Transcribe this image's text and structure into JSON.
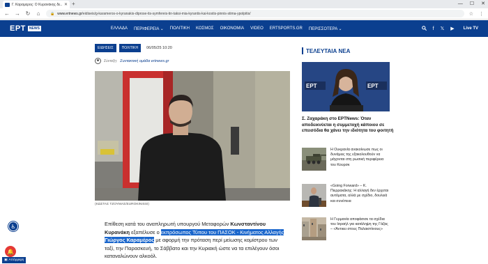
{
  "browser": {
    "tab_title": "Γ. Καραμέρος: Ο Κυρανάκης δε...",
    "new_tab": "+",
    "url_host": "www.ertnews.gr",
    "url_path": "/eidiseis/g-karameros-o-kyranakis-diprose-tis-symfereis-tin-taksi-mia-kyrantis-kai-kostis-pinnis-stima-ypolpitis/",
    "win_controls": [
      "—",
      "☐",
      "✕"
    ]
  },
  "site": {
    "logo": "ΕΡΤ",
    "logo_badge": "NEWS",
    "nav": [
      "ΕΛΛΑΔΑ",
      "ΠΕΡΙΦΕΡΕΙΑ ⌄",
      "ΠΟΛΙΤΙΚΗ",
      "ΚΟΣΜΟΣ",
      "ΟΙΚΟΝΟΜΙΑ",
      "VIDEO",
      "ERTSPORTS.GR",
      "ΠΕΡΙΣΣΟΤΕΡΑ ⌄"
    ],
    "live_label": "Live TV"
  },
  "article": {
    "tags": [
      "ΕΙΔΗΣΕΙΣ",
      "ΠΟΛΙΤΙΚΗ"
    ],
    "date": "06/05/25 10:20",
    "author_label": "Σύνταξη:",
    "author_name": "Συντακτική ομάδα ertnews.gr",
    "photo_caption": "(ΚΩΣΤΑΣ ΤΖΟΥΜΑΣ/EUROKINISSI)",
    "p1": "Επίθεση κατά του αναπληρωτή υπουργού Μεταφορών ",
    "p1_name": "Κωνσταντίνου Κυρανάκη",
    "p2": " εξαπέλυσε ο ",
    "p2_hl": "εκπρόσωπος Τύπου του ΠΑΣΟΚ - Κινήματος Αλλαγής",
    "p2_space": " ",
    "p2_name": "Γιώργος Καραμέρος",
    "p3": " με αφορμή την πρόταση περί μείωσης κομίστρου των ταξί, την Παρασκευή, το Σάββατο και την Κυριακή ώστε να τα επιλέγουν όσοι καταναλώνουν αλκοόλ."
  },
  "sidebar": {
    "title": "ΤΕΛΕΥΤΑΙΑ ΝΕΑ",
    "feature": "Σ. Ζαχαράκη στο ΕΡΤNews: Όταν αποδεικνύεται η συμμετοχή κάποιου σε επεισόδια θα χάνει την ιδιότητα του φοιτητή",
    "items": [
      "Η Ουκρανία ανακοίνωσε πως οι δυνάμεις της εξακολουθούν να μάχονται στη ρωσική περιφέρεια του Κουρσκ",
      "«Going Forward» – Κ. Πιερρακάκης: Η αλλαγή δεν έρχεται αυτόματα, αλλά με σχέδιο, δουλειά και συνέπεια",
      "Η Γερμανία αποφάσισε τα σχέδια του Ισραήλ για κατάληψη της Γάζας – «Άντικει στους Παλαιστίνιους»"
    ]
  },
  "floating": {
    "accessibility": "♿",
    "notify": "🔔",
    "reject_label": "Απόρριψη"
  },
  "icons": {
    "back": "←",
    "forward": "→",
    "reload": "↻",
    "home": "⌂",
    "search": "⚲",
    "star": "☆",
    "menu": "⋮"
  },
  "colors": {
    "brand": "#0b3f8f",
    "highlight": "#1a66cc",
    "notify": "#e53935"
  }
}
